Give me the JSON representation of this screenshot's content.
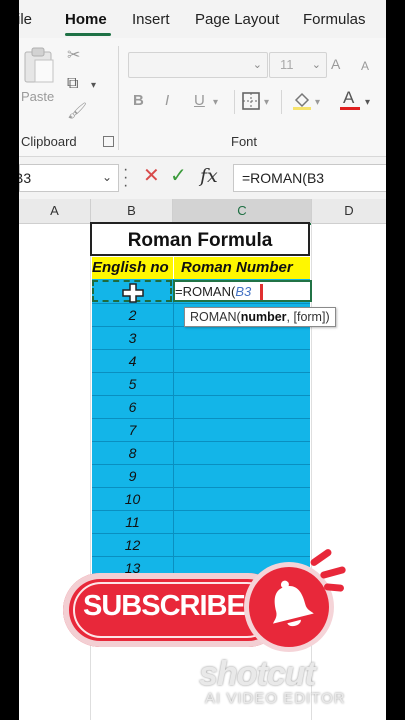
{
  "ribbon": {
    "tabs": [
      {
        "label": "ile"
      },
      {
        "label": "Home"
      },
      {
        "label": "Insert"
      },
      {
        "label": "Page Layout"
      },
      {
        "label": "Formulas"
      }
    ],
    "paste_label": "Paste",
    "clipboard_label": "Clipboard",
    "font_label": "Font",
    "font_size": "11",
    "bold": "B",
    "italic": "I",
    "underline": "U",
    "font_color_letter": "A"
  },
  "formula_bar": {
    "name_box": "B3",
    "fx": "fx",
    "formula": "=ROMAN(B3"
  },
  "columns": [
    "A",
    "B",
    "C",
    "D"
  ],
  "sheet": {
    "title": "Roman Formula",
    "header_b": "English no",
    "header_c": "Roman Number",
    "numbers": [
      "2",
      "3",
      "4",
      "5",
      "6",
      "7",
      "8",
      "9",
      "10",
      "11",
      "12",
      "13"
    ],
    "edit_prefix": "=ROMAN(",
    "edit_ref": "B3",
    "tooltip_fn": "ROMAN(",
    "tooltip_arg": "number",
    "tooltip_rest": ", [form])"
  },
  "overlay": {
    "subscribe": "SUBSCRIBE",
    "watermark_big": "shotcut",
    "watermark_small": "AI VIDEO EDITOR"
  },
  "colors": {
    "excel_green": "#217346",
    "cell_blue": "#13b5e8",
    "header_yellow": "#fff700",
    "subscribe_red": "#e8283a"
  }
}
